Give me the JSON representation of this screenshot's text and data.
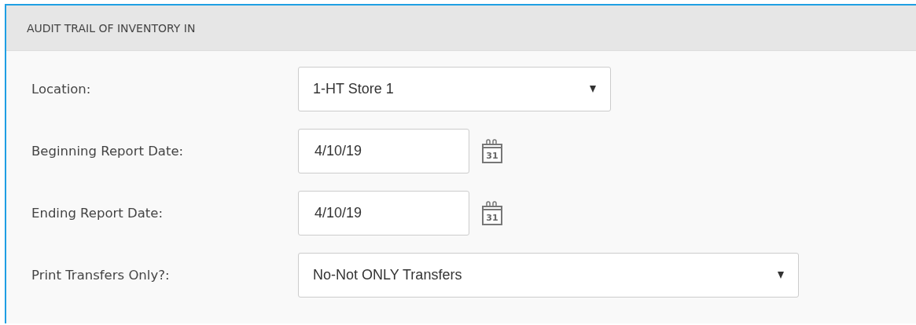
{
  "panel": {
    "title": "AUDIT TRAIL OF INVENTORY IN"
  },
  "fields": [
    {
      "kind": "select",
      "label": "Location:",
      "value": "1-HT Store 1"
    },
    {
      "kind": "date",
      "label": "Beginning Report Date:",
      "value": "4/10/19",
      "icon_text": "31"
    },
    {
      "kind": "date",
      "label": "Ending Report Date:",
      "value": "4/10/19",
      "icon_text": "31"
    },
    {
      "kind": "wideselect",
      "label": "Print Transfers Only?:",
      "value": "No-Not ONLY Transfers"
    }
  ]
}
